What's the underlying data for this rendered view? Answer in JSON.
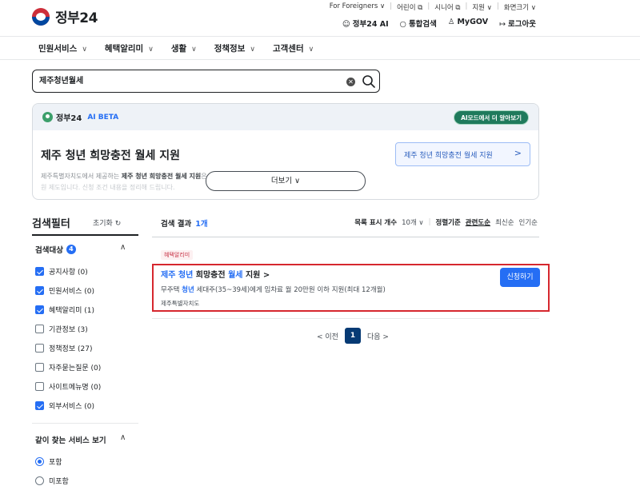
{
  "header": {
    "logo_text": "정부24",
    "top_links": [
      "For Foreigners ∨",
      "어린이 ⧉",
      "시니어 ⧉",
      "지원 ∨",
      "화면크기 ∨"
    ],
    "user_links": [
      {
        "icon": "ai-mascot-icon",
        "label": "정부24 AI"
      },
      {
        "icon": "search-icon",
        "label": "통합검색"
      },
      {
        "icon": "person-icon",
        "label": "MyGOV"
      },
      {
        "icon": "logout-icon",
        "label": "로그아웃"
      }
    ]
  },
  "nav": {
    "items": [
      "민원서비스",
      "혜택알리미",
      "생활",
      "정책정보",
      "고객센터"
    ]
  },
  "search": {
    "value": "제주청년월세"
  },
  "ai": {
    "logo": "정부24",
    "beta": "AI BETA",
    "mode_button": "AI모드에서 더 알아보기",
    "title": "제주 청년 희망충전 월세 지원",
    "body_lead": "제주특별자치도에서 제공하는",
    "body_hl": "제주 청년 희망충전 월세 지원",
    "body_tail": "은 지",
    "body_line2": "원 제도입니다. 신청 조건 내용을 정리해 드립니다.",
    "more_button": "더보기 ∨",
    "link_label": "제주 청년 희망충전 월세 지원"
  },
  "filter": {
    "title": "검색필터",
    "reset": "초기화 ↻",
    "target_label": "검색대상",
    "target_count": "4",
    "items": [
      {
        "label": "공지사항 (0)",
        "checked": true
      },
      {
        "label": "민원서비스 (0)",
        "checked": true
      },
      {
        "label": "혜택알리미 (1)",
        "checked": true
      },
      {
        "label": "기관정보 (3)",
        "checked": false
      },
      {
        "label": "정책정보 (27)",
        "checked": false
      },
      {
        "label": "자주묻는질문 (0)",
        "checked": false
      },
      {
        "label": "사이트메뉴명 (0)",
        "checked": false
      },
      {
        "label": "외부서비스 (0)",
        "checked": true
      }
    ],
    "related_label": "같이 찾는 서비스 보기",
    "radio_include": "포함",
    "radio_exclude": "미포함"
  },
  "results": {
    "label": "검색 결과",
    "count": "1개",
    "per_page_label": "목록 표시 개수",
    "per_page_value": "10개 ∨",
    "sort_label": "정렬기준",
    "sort_options": [
      "관련도순",
      "최신순",
      "인기순"
    ],
    "tag": "혜택알리미",
    "item": {
      "title_kw1": "제주",
      "title_kw2": "청년",
      "title_mid": "희망충전",
      "title_kw3": "월세",
      "title_end": "지원 >",
      "desc_pre": "무주택",
      "desc_kw": "청년",
      "desc_post": "세대주(35~39세)에게 임차료 월 20만원 이하 지원(최대 12개월)",
      "org": "제주특별자치도",
      "apply": "신청하기"
    },
    "pager": {
      "prev": "< 이전",
      "current": "1",
      "next": "다음 >"
    }
  }
}
